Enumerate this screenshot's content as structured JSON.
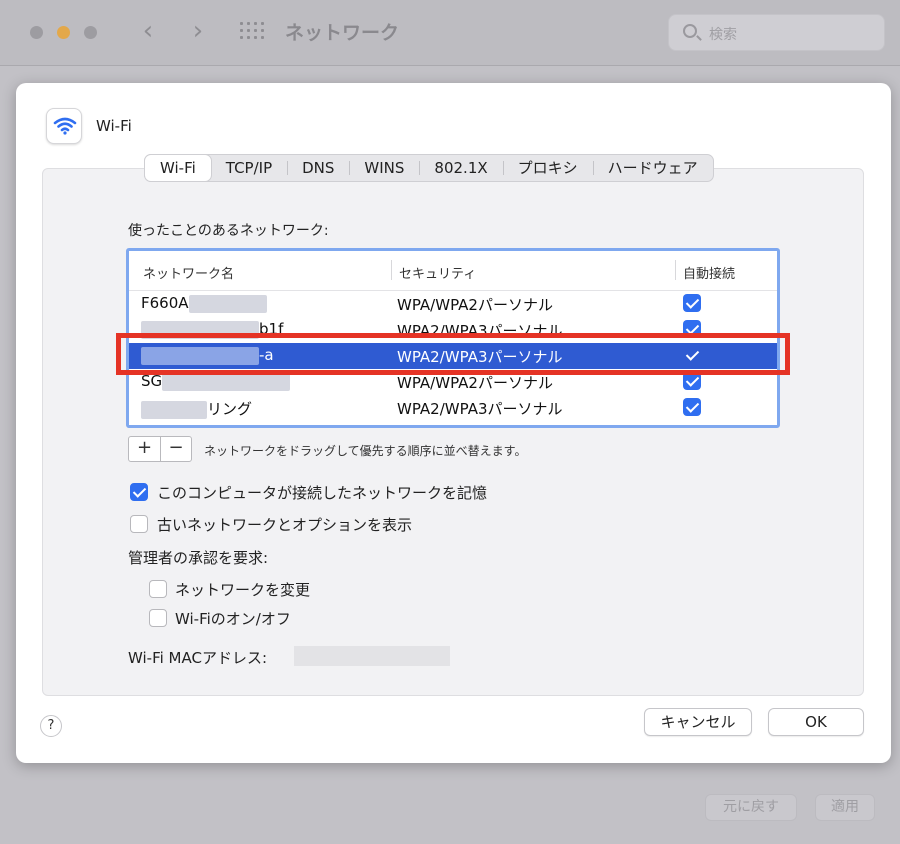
{
  "window": {
    "title": "ネットワーク",
    "search_placeholder": "検索",
    "back_glyph": "‹",
    "forward_glyph": "›",
    "revert_label": "元に戻す",
    "apply_label": "適用"
  },
  "sheet": {
    "title": "Wi-Fi",
    "tabs": [
      "Wi-Fi",
      "TCP/IP",
      "DNS",
      "WINS",
      "802.1X",
      "プロキシ",
      "ハードウェア"
    ],
    "active_tab": "Wi-Fi",
    "used_networks_label": "使ったことのあるネットワーク:",
    "columns": {
      "name": "ネットワーク名",
      "security": "セキュリティ",
      "auto": "自動接続"
    },
    "networks": [
      {
        "name": "F660A",
        "security": "WPA/WPA2パーソナル",
        "auto_join": true,
        "selected": false
      },
      {
        "name": "b1f",
        "security": "WPA2/WPA3パーソナル",
        "auto_join": true,
        "selected": false
      },
      {
        "name": "-a",
        "security": "WPA2/WPA3パーソナル",
        "auto_join": true,
        "selected": true
      },
      {
        "name": "SG",
        "security": "WPA/WPA2パーソナル",
        "auto_join": true,
        "selected": false
      },
      {
        "name": "リング",
        "security": "WPA2/WPA3パーソナル",
        "auto_join": true,
        "selected": false
      }
    ],
    "add_label": "+",
    "remove_label": "−",
    "drag_hint": "ネットワークをドラッグして優先する順序に並べ替えます。",
    "remember_label": "このコンピュータが接続したネットワークを記憶",
    "remember_checked": true,
    "legacy_label": "古いネットワークとオプションを表示",
    "legacy_checked": false,
    "admin_label": "管理者の承認を要求:",
    "change_network_label": "ネットワークを変更",
    "change_network_checked": false,
    "wifi_toggle_label": "Wi-Fiのオン/オフ",
    "wifi_toggle_checked": false,
    "mac_label": "Wi-Fi MACアドレス:",
    "help_label": "?",
    "cancel_label": "キャンセル",
    "ok_label": "OK"
  },
  "colors": {
    "accent": "#2f6ef0",
    "selection": "#2f5bd2",
    "highlight_box": "#e53325"
  }
}
